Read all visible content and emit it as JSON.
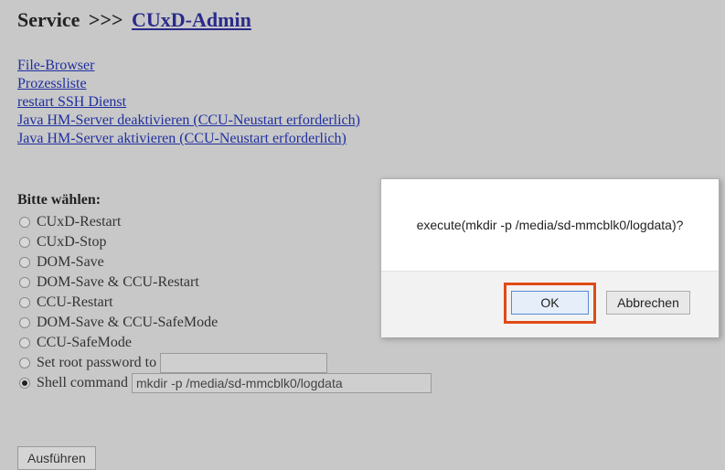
{
  "header": {
    "section": "Service",
    "separator": ">>>",
    "link": "CUxD-Admin"
  },
  "links": [
    "File-Browser",
    "Prozessliste",
    "restart SSH Dienst",
    "Java HM-Server deaktivieren (CCU-Neustart erforderlich)",
    "Java HM-Server aktivieren (CCU-Neustart erforderlich)"
  ],
  "form": {
    "choose_label": "Bitte wählen:",
    "options": [
      {
        "label": "CUxD-Restart",
        "checked": false
      },
      {
        "label": "CUxD-Stop",
        "checked": false
      },
      {
        "label": "DOM-Save",
        "checked": false
      },
      {
        "label": "DOM-Save & CCU-Restart",
        "checked": false
      },
      {
        "label": "CCU-Restart",
        "checked": false
      },
      {
        "label": "DOM-Save & CCU-SafeMode",
        "checked": false
      },
      {
        "label": "CCU-SafeMode",
        "checked": false
      },
      {
        "label": "Set root password to",
        "checked": false
      },
      {
        "label": "Shell command",
        "checked": true
      }
    ],
    "password_value": "",
    "shell_command_value": "mkdir -p /media/sd-mmcblk0/logdata",
    "submit_label": "Ausführen"
  },
  "dialog": {
    "message": "execute(mkdir -p /media/sd-mmcblk0/logdata)?",
    "ok_label": "OK",
    "cancel_label": "Abbrechen",
    "highlight_color": "#e04a17"
  }
}
